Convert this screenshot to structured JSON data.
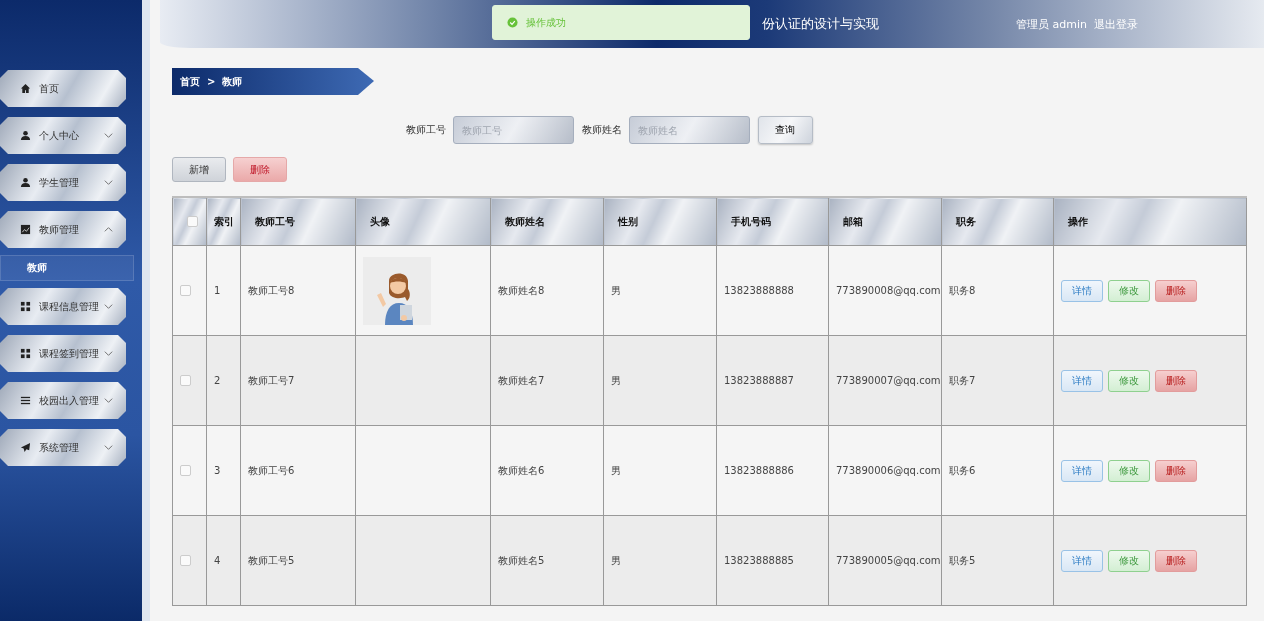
{
  "header": {
    "title": "份认证的设计与实现",
    "user": "管理员 admin",
    "logout": "退出登录"
  },
  "toast": {
    "message": "操作成功"
  },
  "sidebar": {
    "items": [
      {
        "label": "首页",
        "kind": "link"
      },
      {
        "label": "个人中心",
        "kind": "group",
        "expanded": false
      },
      {
        "label": "学生管理",
        "kind": "group",
        "expanded": false
      },
      {
        "label": "教师管理",
        "kind": "group",
        "expanded": true,
        "children": [
          {
            "label": "教师",
            "selected": true
          }
        ]
      },
      {
        "label": "课程信息管理",
        "kind": "group",
        "expanded": false
      },
      {
        "label": "课程签到管理",
        "kind": "group",
        "expanded": false
      },
      {
        "label": "校园出入管理",
        "kind": "group",
        "expanded": false
      },
      {
        "label": "系统管理",
        "kind": "group",
        "expanded": false
      }
    ]
  },
  "breadcrumb": {
    "items": [
      "首页",
      "教师"
    ],
    "separator": ">"
  },
  "search": {
    "fields": [
      {
        "label": "教师工号",
        "placeholder": "教师工号"
      },
      {
        "label": "教师姓名",
        "placeholder": "教师姓名"
      }
    ],
    "button": "查询"
  },
  "actions": [
    {
      "label": "新增",
      "kind": "add"
    },
    {
      "label": "删除",
      "kind": "delete"
    }
  ],
  "table": {
    "select_all": {
      "checked": false
    },
    "columns": [
      "索引",
      "教师工号",
      "头像",
      "教师姓名",
      "性别",
      "手机号码",
      "邮箱",
      "职务",
      "操作"
    ],
    "rows": [
      {
        "checked": false,
        "cells": [
          "1",
          "教师工号8",
          null,
          "教师姓名8",
          "男",
          "13823888888",
          "773890008@qq.com",
          "职务8"
        ],
        "avatar": {
          "kind": "picture"
        },
        "actions": [
          {
            "label": "详情",
            "kind": "detail"
          },
          {
            "label": "修改",
            "kind": "edit"
          },
          {
            "label": "删除",
            "kind": "delete"
          }
        ]
      },
      {
        "checked": false,
        "cells": [
          "2",
          "教师工号7",
          null,
          "教师姓名7",
          "男",
          "13823888887",
          "773890007@qq.com",
          "职务7"
        ],
        "actions": [
          {
            "label": "详情",
            "kind": "detail"
          },
          {
            "label": "修改",
            "kind": "edit"
          },
          {
            "label": "删除",
            "kind": "delete"
          }
        ]
      },
      {
        "checked": false,
        "cells": [
          "3",
          "教师工号6",
          null,
          "教师姓名6",
          "男",
          "13823888886",
          "773890006@qq.com",
          "职务6"
        ],
        "actions": [
          {
            "label": "详情",
            "kind": "detail"
          },
          {
            "label": "修改",
            "kind": "edit"
          },
          {
            "label": "删除",
            "kind": "delete"
          }
        ]
      },
      {
        "checked": false,
        "cells": [
          "4",
          "教师工号5",
          null,
          "教师姓名5",
          "男",
          "13823888885",
          "773890005@qq.com",
          "职务5"
        ],
        "actions": [
          {
            "label": "详情",
            "kind": "detail"
          },
          {
            "label": "修改",
            "kind": "edit"
          },
          {
            "label": "删除",
            "kind": "delete"
          }
        ]
      }
    ]
  }
}
